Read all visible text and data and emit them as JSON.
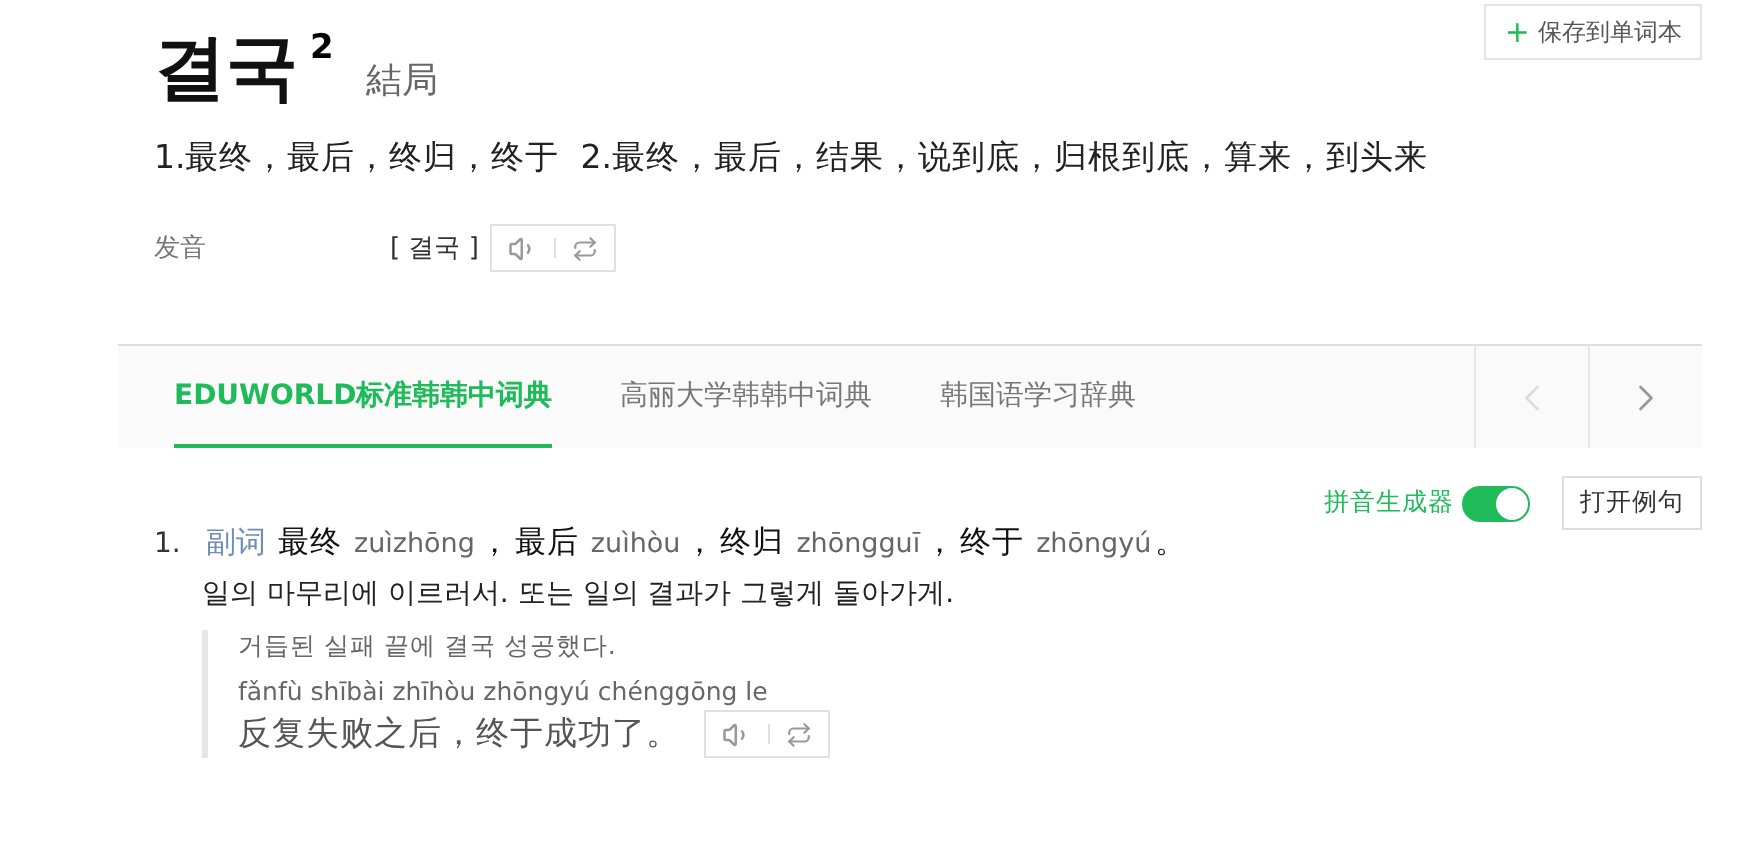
{
  "save_button": {
    "icon": "+",
    "label": "保存到单词本"
  },
  "headword": {
    "word": "결국",
    "homograph": "2",
    "hanja": "結局"
  },
  "summary": "1.最终，最后，终归，终于  2.最终，最后，结果，说到底，归根到底，算来，到头来",
  "pronunciation": {
    "label": "发音",
    "reading": "[ 결국 ]"
  },
  "tabs": [
    {
      "label": "EDUWORLD标准韩韩中词典",
      "selected": true
    },
    {
      "label": "高丽大学韩韩中词典",
      "selected": false
    },
    {
      "label": "韩国语学习辞典",
      "selected": false
    }
  ],
  "tab_nav": {
    "prev_disabled": true,
    "next_disabled": false
  },
  "pinyin_toggle": {
    "label": "拼音生成器",
    "on": true
  },
  "examples_button": "打开例句",
  "senses": [
    {
      "number": "1.",
      "pos": "副词",
      "terms": [
        {
          "word": "最终",
          "pinyin": "zuìzhōng",
          "punct": "，"
        },
        {
          "word": "最后",
          "pinyin": "zuìhòu",
          "punct": "，"
        },
        {
          "word": "终归",
          "pinyin": "zhōngguī",
          "punct": "，"
        },
        {
          "word": "终于",
          "pinyin": "zhōngyú",
          "punct": "。"
        }
      ],
      "definition": "일의 마무리에 이르러서. 또는 일의 결과가 그렇게 돌아가게.",
      "examples": [
        {
          "korean": "거듭된 실패 끝에 결국 성공했다.",
          "pinyin": "fǎnfù shībài zhīhòu zhōngyú chénggōng le",
          "chinese": "反复失败之后，终于成功了。"
        }
      ]
    }
  ]
}
